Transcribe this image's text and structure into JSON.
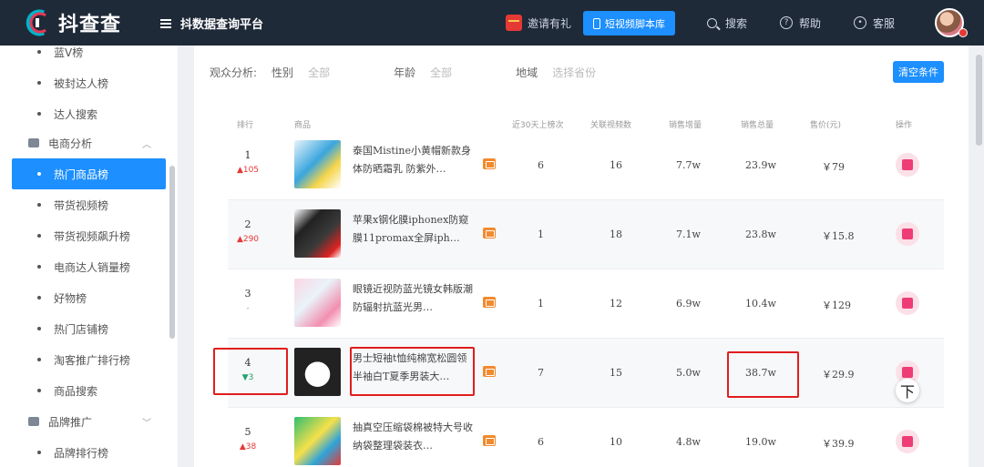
{
  "app": {
    "logo_text": "抖查查",
    "platform_title": "抖数据查询平台"
  },
  "header": {
    "invite_label": "邀请有礼",
    "video_library_label": "短视频脚本库",
    "search_label": "搜索",
    "help_label": "帮助",
    "service_label": "客服"
  },
  "sidebar": {
    "items_top": [
      {
        "label": "蓝V榜"
      },
      {
        "label": "被封达人榜"
      },
      {
        "label": "达人搜索"
      }
    ],
    "group_ecommerce": "电商分析",
    "items_ecommerce": [
      {
        "label": "热门商品榜",
        "active": true
      },
      {
        "label": "带货视频榜"
      },
      {
        "label": "带货视频飙升榜"
      },
      {
        "label": "电商达人销量榜"
      },
      {
        "label": "好物榜"
      },
      {
        "label": "热门店铺榜"
      },
      {
        "label": "淘客推广排行榜"
      },
      {
        "label": "商品搜索"
      }
    ],
    "group_brand": "品牌推广",
    "items_brand": [
      {
        "label": "品牌排行榜"
      }
    ]
  },
  "filters": {
    "label": "观众分析:",
    "gender_label": "性别",
    "gender_value": "全部",
    "age_label": "年龄",
    "age_value": "全部",
    "region_label": "地域",
    "region_value": "选择省份",
    "clear_label": "清空条件"
  },
  "table": {
    "headers": {
      "rank": "排行",
      "product": "商品",
      "days30": "近30天上榜次",
      "video_count": "关联视频数",
      "sales_growth": "销售增量",
      "sales_total": "销售总量",
      "price": "售价(元)",
      "action": "操作"
    },
    "rows": [
      {
        "rank": "1",
        "delta": "▲105",
        "trend": "up",
        "title": "泰国Mistine小黄帽新款身体防晒霜乳 防紫外…",
        "days": "6",
        "videos": "16",
        "growth": "7.7w",
        "total": "23.9w",
        "price": "￥79"
      },
      {
        "rank": "2",
        "delta": "▲290",
        "trend": "up",
        "title": "苹果x钢化膜iphonex防窥膜11promax全屏iph…",
        "days": "1",
        "videos": "18",
        "growth": "7.1w",
        "total": "23.8w",
        "price": "￥15.8"
      },
      {
        "rank": "3",
        "delta": "-",
        "trend": "flat",
        "title": "眼镜近视防蓝光镜女韩版潮防辐射抗蓝光男…",
        "days": "1",
        "videos": "12",
        "growth": "6.9w",
        "total": "10.4w",
        "price": "￥129"
      },
      {
        "rank": "4",
        "delta": "▼3",
        "trend": "down",
        "title": "男士短袖t恤纯棉宽松圆领半袖白T夏季男装大…",
        "days": "7",
        "videos": "15",
        "growth": "5.0w",
        "total": "38.7w",
        "price": "￥29.9"
      },
      {
        "rank": "5",
        "delta": "▲38",
        "trend": "up",
        "title": "抽真空压缩袋棉被特大号收纳袋整理袋装衣…",
        "days": "6",
        "videos": "10",
        "growth": "4.8w",
        "total": "19.0w",
        "price": "￥39.9"
      }
    ]
  },
  "back_to_top": "下",
  "colors": {
    "header_bg": "#1f2a38",
    "accent": "#1d8ffe",
    "up": "#e53935",
    "down": "#22a36b",
    "highlight_box": "#e11d1d"
  }
}
